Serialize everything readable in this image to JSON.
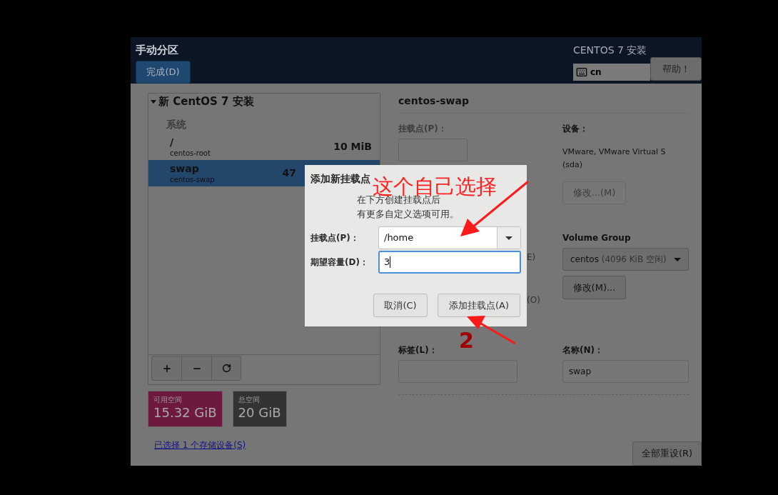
{
  "header": {
    "title": "手动分区",
    "done_button": "完成(D)",
    "product": "CENTOS 7 安装",
    "keyboard": "cn",
    "help_button": "帮助！"
  },
  "tree": {
    "label": "新 CentOS 7 安装",
    "expanded": true,
    "groups": [
      {
        "label": "系统",
        "items": [
          {
            "mount": "/",
            "device": "centos-root",
            "size": "10 MiB",
            "selected": false
          },
          {
            "mount": "swap",
            "device": "centos-swap",
            "size": "47",
            "selected": true
          }
        ]
      }
    ]
  },
  "space": [
    {
      "label": "可用空间",
      "value": "15.32 GiB",
      "color": "#6e1a40"
    },
    {
      "label": "总空间",
      "value": "20 GiB",
      "color": "#333333"
    }
  ],
  "storage_link": "已选择 1 个存储设备(S)",
  "details": {
    "title": "centos-swap",
    "mount_label": "挂载点(P)：",
    "mount_disabled": true,
    "device_label": "设备：",
    "device_lines": [
      "VMware, VMware Virtual S",
      "(sda)"
    ],
    "device_modify": {
      "label": "修改...(M)",
      "disabled": true
    },
    "fragments": [
      "E)",
      "(O)"
    ],
    "vg_label": "Volume Group",
    "vg_value": "centos",
    "vg_free": "(4096 KiB 空闲)",
    "vg_modify": {
      "label": "修改(M)...",
      "disabled": false
    },
    "label_label": "标签(L)：",
    "name_label": "名称(N)：",
    "name_value": "swap",
    "reset_button": "全部重设(R)"
  },
  "dialog": {
    "title": "添加新挂载点",
    "description": [
      "在下方创建挂载点后",
      "有更多自定义选项可用。"
    ],
    "mount_label": "挂载点(P)：",
    "mount_value": "/home",
    "capacity_label": "期望容量(D)：",
    "capacity_value": "3",
    "cancel_button": "取消(C)",
    "add_button": "添加挂载点(A)"
  },
  "annotations": [
    {
      "kind": "note",
      "text": "这个自己选择"
    },
    {
      "kind": "step",
      "text": "2"
    }
  ]
}
